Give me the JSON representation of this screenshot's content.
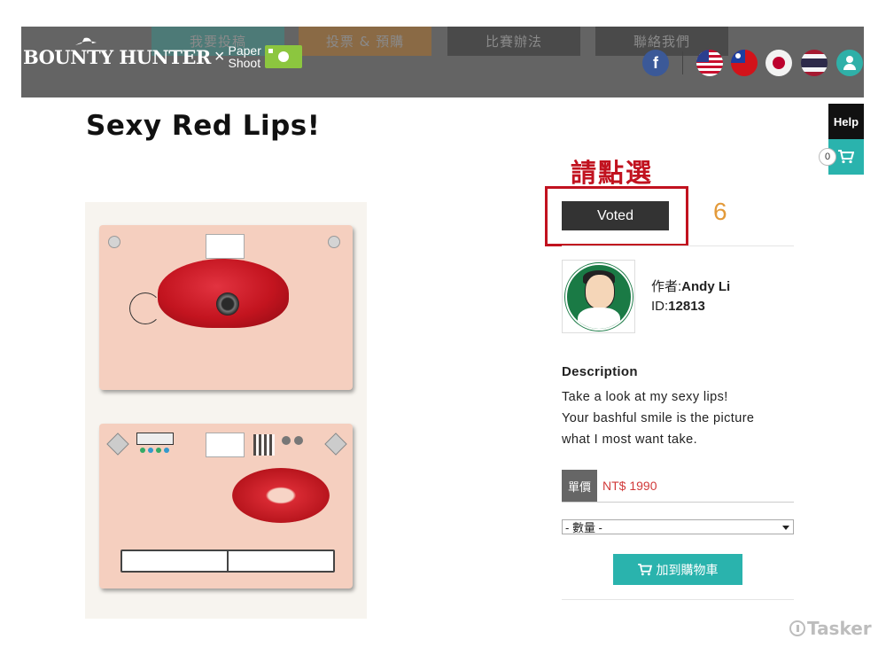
{
  "header": {
    "nav": [
      "我要投稿",
      "投票 & 預購",
      "比賽辦法",
      "聯絡我們"
    ],
    "logo_brand": "BOUNTY HUNTER",
    "logo_x": "×",
    "logo_partner_line1": "Paper",
    "logo_partner_line2": "Shoot",
    "social_icon": "facebook-icon",
    "flags": [
      "us-flag",
      "taiwan-flag",
      "japan-flag",
      "thailand-flag"
    ],
    "user_icon": "user-icon"
  },
  "side": {
    "help_label": "Help",
    "cart_count": "0"
  },
  "product": {
    "title": "Sexy Red Lips!",
    "pick_label": "請點選",
    "vote_button": "Voted",
    "vote_count": "6",
    "author_prefix": "作者:",
    "author_name": "Andy Li",
    "id_prefix": "ID:",
    "id_value": "12813",
    "description_heading": "Description",
    "description_lines": [
      "Take a look at my sexy lips!",
      "Your bashful smile is the picture",
      "what I most want take."
    ],
    "price_label": "單價",
    "price_value": "NT$ 1990",
    "quantity_placeholder": "- 數量 -",
    "add_to_cart": "加到購物車"
  },
  "watermark": "Tasker",
  "colors": {
    "header_bg": "#646464",
    "accent": "#2ab3ad",
    "highlight_red": "#c1121f",
    "count_orange": "#e39a3a"
  }
}
